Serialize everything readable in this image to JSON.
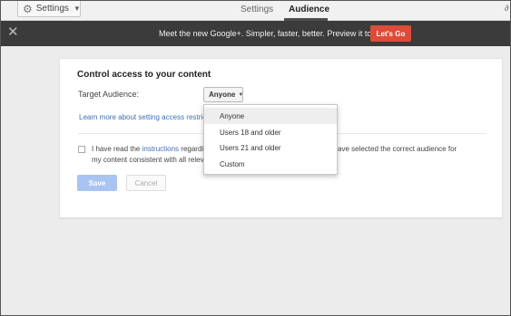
{
  "topbar": {
    "settings_label": "Settings",
    "gear_icon": "gear-icon",
    "tabs": [
      {
        "label": "Settings",
        "active": false
      },
      {
        "label": "Audience",
        "active": true
      }
    ]
  },
  "banner": {
    "text": "Meet the new Google+.  Simpler, faster, better. Preview it today.",
    "cta_label": "Let's Go",
    "close_glyph": "✕",
    "colors": {
      "background": "#3b3b3b",
      "cta": "#dd4b39"
    }
  },
  "card": {
    "title": "Control access to your content",
    "target_label": "Target Audience:",
    "selected_audience": "Anyone",
    "learn_link": "Learn more about setting access restrictions",
    "consent_prefix": "I have read the ",
    "consent_link": "instructions",
    "consent_suffix": " regardin",
    "consent_right": "ave selected the correct audience for",
    "consent_line2": "my content consistent with all relev",
    "save_label": "Save",
    "cancel_label": "Cancel",
    "accent_color": "#a9c4f2"
  },
  "menu": {
    "options": [
      "Anyone",
      "Users 18 and older",
      "Users 21 and older",
      "Custom"
    ],
    "highlighted": "Anyone"
  }
}
